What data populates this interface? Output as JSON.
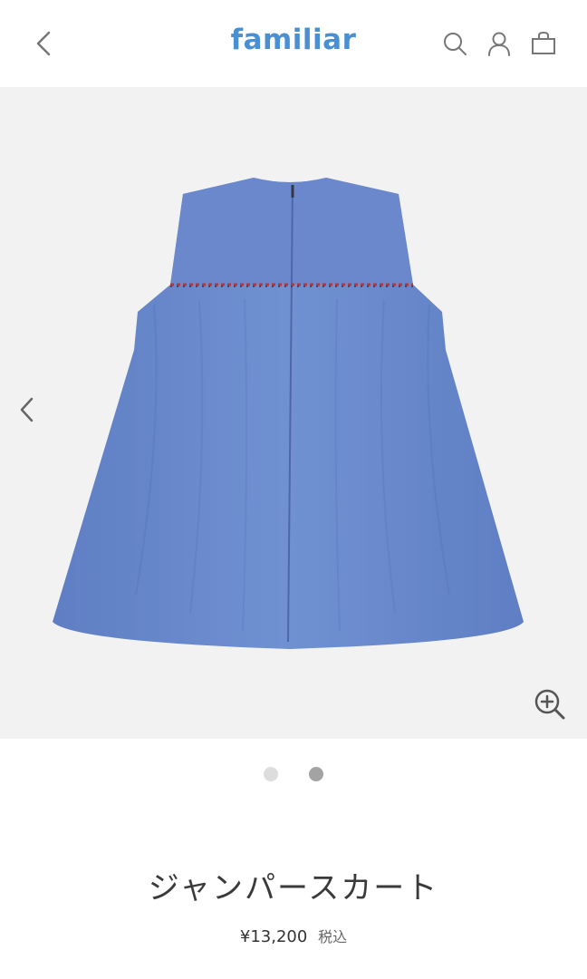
{
  "header": {
    "logo": "familiar",
    "brand_color": "#4a8fd1",
    "back_icon": "chevron-left-icon",
    "icons": [
      "search-icon",
      "user-icon",
      "shopping-bag-icon"
    ]
  },
  "gallery": {
    "image_alt": "ジャンパースカート",
    "prev_icon": "chevron-left-icon",
    "zoom_icon": "zoom-in-icon",
    "total_slides": 2,
    "active_slide": 2
  },
  "product": {
    "name": "ジャンパースカート",
    "price": "¥13,200",
    "tax_label": "税込"
  }
}
